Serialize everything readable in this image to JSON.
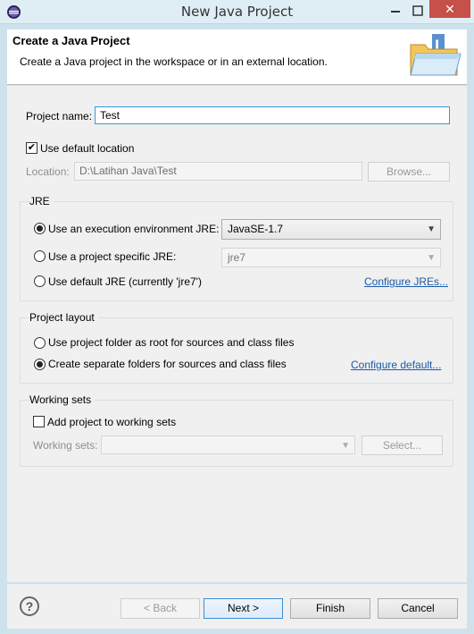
{
  "window": {
    "title": "New Java Project",
    "close_glyph": "✕",
    "minimize_glyph": "–",
    "maximize_glyph": "☐"
  },
  "header": {
    "title": "Create a Java Project",
    "description": "Create a Java project in the workspace or in an external location."
  },
  "project": {
    "name_label": "Project name:",
    "name_value": "Test",
    "use_default_location_label": "Use default location",
    "use_default_location_checked": true,
    "location_label": "Location:",
    "location_value": "D:\\Latihan Java\\Test",
    "browse_label": "Browse..."
  },
  "jre": {
    "group_label": "JRE",
    "options": [
      {
        "label": "Use an execution environment JRE:",
        "selected": true,
        "combo_value": "JavaSE-1.7",
        "combo_enabled": true
      },
      {
        "label": "Use a project specific JRE:",
        "selected": false,
        "combo_value": "jre7",
        "combo_enabled": false
      },
      {
        "label": "Use default JRE (currently 'jre7')",
        "selected": false
      }
    ],
    "configure_link": "Configure JREs..."
  },
  "layout": {
    "group_label": "Project layout",
    "options": [
      {
        "label": "Use project folder as root for sources and class files",
        "selected": false
      },
      {
        "label": "Create separate folders for sources and class files",
        "selected": true
      }
    ],
    "configure_link": "Configure default..."
  },
  "working_sets": {
    "group_label": "Working sets",
    "add_label": "Add project to working sets",
    "add_checked": false,
    "sets_label": "Working sets:",
    "sets_value": "",
    "select_label": "Select..."
  },
  "footer": {
    "help_glyph": "?",
    "back_label": "< Back",
    "next_label": "Next >",
    "finish_label": "Finish",
    "cancel_label": "Cancel"
  },
  "icons": {
    "app": "eclipse-icon",
    "wizard": "java-project-folder-icon",
    "help": "help-icon"
  }
}
